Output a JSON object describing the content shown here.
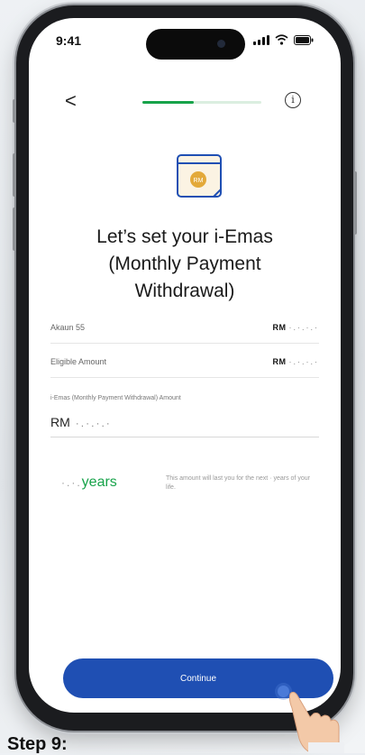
{
  "status_bar": {
    "time": "9:41"
  },
  "nav": {
    "back_glyph": "<",
    "info_glyph": "i",
    "progress_fraction": 0.43
  },
  "hero": {
    "icon_text": "RM"
  },
  "title": {
    "line1": "Let’s set your i-Emas",
    "line2": "(Monthly Payment",
    "line3": "Withdrawal)"
  },
  "rows": [
    {
      "label": "Akaun 55",
      "currency": "RM",
      "value_masked": "·.·.·.·"
    },
    {
      "label": "Eligible Amount",
      "currency": "RM",
      "value_masked": "·.·.·.·"
    }
  ],
  "amount_field": {
    "label": "i-Emas (Monthly Payment Withdrawal) Amount",
    "currency": "RM",
    "value_masked": "·.·.·.·"
  },
  "duration": {
    "value_masked": "·.·.",
    "unit": "years",
    "note_part1": "This amount will last you for the next",
    "note_masked": "·",
    "note_part2": "years of your life."
  },
  "buttons": {
    "continue_label": "Continue"
  },
  "caption": "Step 9:",
  "colors": {
    "accent_green": "#17a34a",
    "primary_blue": "#1f4fb3",
    "icon_gold": "#e3a93a"
  }
}
